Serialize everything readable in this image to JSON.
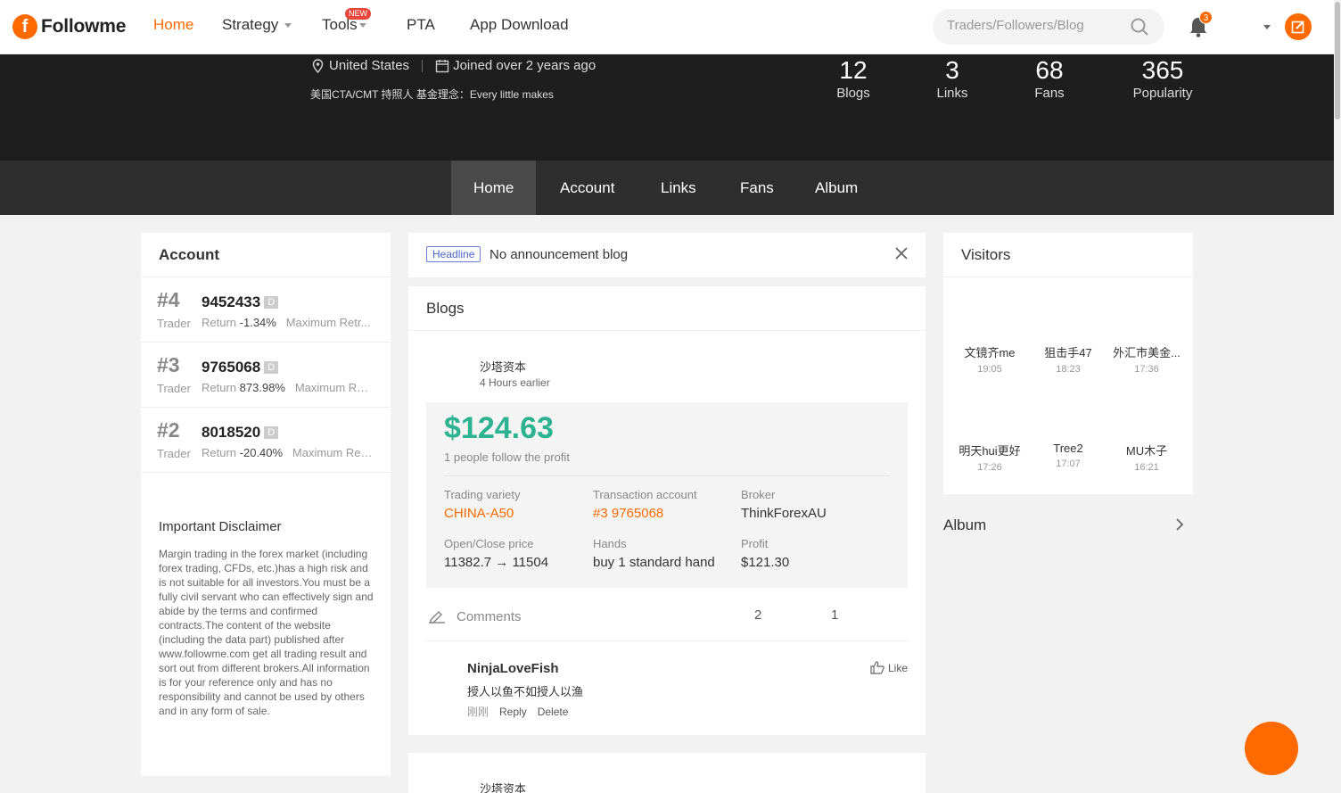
{
  "brand": {
    "name": "Followme"
  },
  "nav": {
    "items": [
      {
        "label": "Home"
      },
      {
        "label": "Strategy"
      },
      {
        "label": "Tools",
        "badge": "NEW"
      },
      {
        "label": "PTA"
      },
      {
        "label": "App Download"
      }
    ],
    "search_placeholder": "Traders/Followers/Blog",
    "notification_count": "3"
  },
  "profile": {
    "location": "United States",
    "joined": "Joined over 2 years ago",
    "bio": "美国CTA/CMT 持照人 基金理念：Every little makes",
    "stats": [
      {
        "num": "12",
        "label": "Blogs"
      },
      {
        "num": "3",
        "label": "Links"
      },
      {
        "num": "68",
        "label": "Fans"
      },
      {
        "num": "365",
        "label": "Popularity"
      }
    ]
  },
  "subnav": {
    "items": [
      {
        "label": "Home"
      },
      {
        "label": "Account"
      },
      {
        "label": "Links"
      },
      {
        "label": "Fans"
      },
      {
        "label": "Album"
      }
    ]
  },
  "account": {
    "title": "Account",
    "rows": [
      {
        "rank": "#4",
        "id": "9452433",
        "badge": "D",
        "role": "Trader",
        "return_label": "Return",
        "return_value": "-1.34%",
        "extra": "Maximum Retr..."
      },
      {
        "rank": "#3",
        "id": "9765068",
        "badge": "D",
        "role": "Trader",
        "return_label": "Return",
        "return_value": "873.98%",
        "extra": "Maximum Re..."
      },
      {
        "rank": "#2",
        "id": "8018520",
        "badge": "D",
        "role": "Trader",
        "return_label": "Return",
        "return_value": "-20.40%",
        "extra": "Maximum Ret..."
      }
    ],
    "disclaimer_title": "Important Disclaimer",
    "disclaimer_body": "Margin trading in the forex market (including forex trading, CFDs, etc.)has a high risk and is not suitable for all investors.You must be a fully civil servant who can effectively sign and abide by the terms and confirmed contracts.The content of the website (including the data part) published after www.followme.com get all trading result and sort out from different brokers.All information is for your reference only and has no responsibility and cannot be used by others and in any form of sale."
  },
  "headline": {
    "tag": "Headline",
    "text": "No announcement blog"
  },
  "blogs": {
    "title": "Blogs",
    "post": {
      "author": "沙塔资本",
      "time": "4 Hours earlier",
      "profit": "$124.63",
      "profit_sub": "1 people follow the profit",
      "fields": [
        {
          "key": "Trading variety",
          "value": "CHINA-A50"
        },
        {
          "key": "Transaction account",
          "value": "#3 9765068"
        },
        {
          "key": "Broker",
          "value": "ThinkForexAU"
        },
        {
          "key": "Open/Close price",
          "value": "11382.7 → 11504"
        },
        {
          "key": "Hands",
          "value": "buy 1 standard hand"
        },
        {
          "key": "Profit",
          "value": "$121.30"
        }
      ],
      "comments_label": "Comments",
      "count_a": "2",
      "count_b": "1",
      "comment": {
        "author": "NinjaLoveFish",
        "text": "授人以鱼不如授人以渔",
        "time": "刚刚",
        "reply": "Reply",
        "delete": "Delete",
        "like": "Like"
      }
    },
    "post2_author": "沙塔资本"
  },
  "visitors": {
    "title": "Visitors",
    "items": [
      {
        "name": "文镜齐me",
        "time": "19:05"
      },
      {
        "name": "狙击手47",
        "time": "18:23"
      },
      {
        "name": "外汇市美金...",
        "time": "17:36"
      },
      {
        "name": "明天hui更好",
        "time": "17:26"
      },
      {
        "name": "Tree2",
        "time": "17:07"
      },
      {
        "name": "MU木子",
        "time": "16:21"
      }
    ]
  },
  "album": {
    "label": "Album"
  },
  "colors": {
    "accent": "#ff6a00",
    "profit_green": "#2db391",
    "banner": "#1e1e1e",
    "subnav": "#2e2e2e"
  }
}
